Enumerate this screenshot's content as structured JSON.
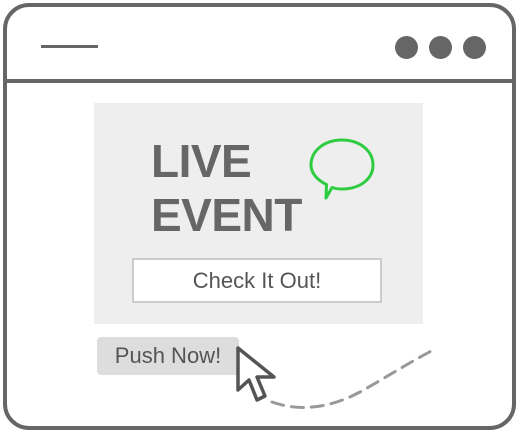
{
  "banner": {
    "headline_line1": "LIVE",
    "headline_line2": "EVENT",
    "cta_label": "Check It Out!",
    "chat_icon": "speech-bubble-icon",
    "accent_color": "#2ecc40"
  },
  "action": {
    "push_label": "Push Now!",
    "cursor_icon": "arrow-cursor-icon"
  },
  "window": {
    "menu_icon": "menu-line-icon",
    "controls_icon": "three-dots-icon"
  }
}
